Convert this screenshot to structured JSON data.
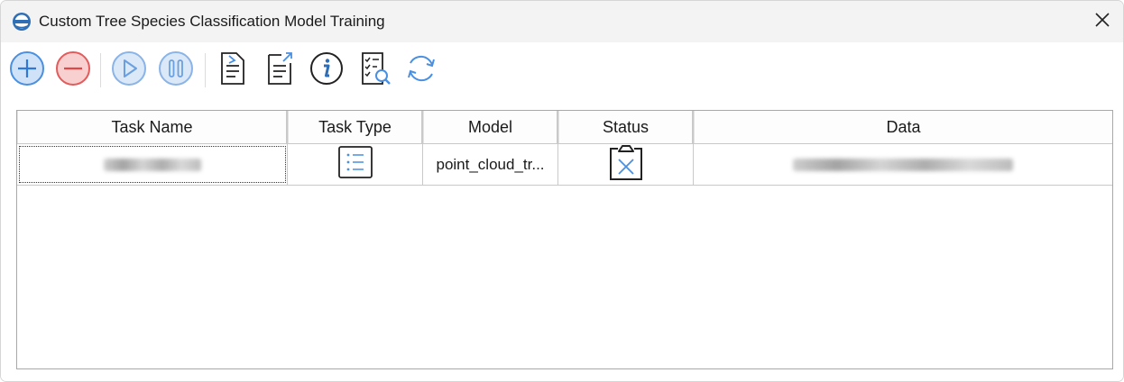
{
  "window": {
    "title": "Custom Tree Species Classification Model Training",
    "app_icon": "app-logo-icon",
    "close_icon": "close-icon"
  },
  "toolbar": {
    "buttons": [
      {
        "name": "add-task-button",
        "icon": "plus-circle-icon",
        "color": "#4a8fe0"
      },
      {
        "name": "remove-task-button",
        "icon": "minus-circle-icon",
        "color": "#e35b5b"
      },
      {
        "name": "start-task-button",
        "icon": "play-circle-icon",
        "color": "#8ab4e8"
      },
      {
        "name": "pause-task-button",
        "icon": "pause-circle-icon",
        "color": "#8ab4e8"
      },
      {
        "name": "import-button",
        "icon": "document-import-icon",
        "color": "#222222"
      },
      {
        "name": "export-button",
        "icon": "document-export-icon",
        "color": "#222222"
      },
      {
        "name": "info-button",
        "icon": "info-icon",
        "color": "#222222"
      },
      {
        "name": "view-log-button",
        "icon": "checklist-search-icon",
        "color": "#222222"
      },
      {
        "name": "refresh-button",
        "icon": "refresh-icon",
        "color": "#4a8fe0"
      }
    ]
  },
  "table": {
    "columns": [
      "Task Name",
      "Task Type",
      "Model",
      "Status",
      "Data"
    ],
    "rows": [
      {
        "task_type_icon": "list-document-icon",
        "model": "point_cloud_tr...",
        "status_icon": "clipboard-failed-icon"
      }
    ]
  }
}
